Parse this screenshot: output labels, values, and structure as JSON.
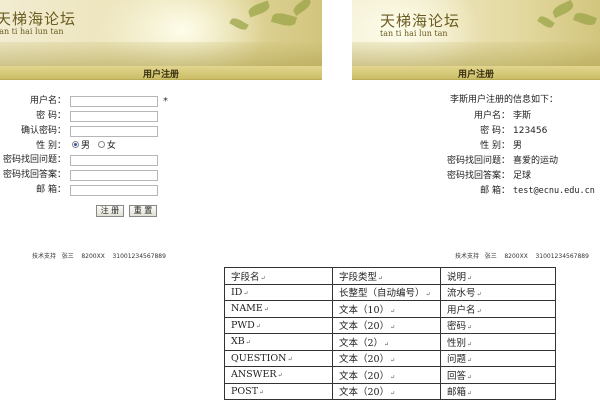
{
  "site": {
    "title": "天梯海论坛",
    "subtitle": "tan ti hai lun tan"
  },
  "register_form": {
    "section_title": "用户注册",
    "fields": [
      {
        "label": "用户名：",
        "value": "",
        "required_mark": "*"
      },
      {
        "label": "密  码：",
        "value": ""
      },
      {
        "label": "确认密码：",
        "value": ""
      },
      {
        "label": "性  别："
      },
      {
        "label": "密码找回问题：",
        "value": ""
      },
      {
        "label": "密码找回答案：",
        "value": ""
      },
      {
        "label": "邮  箱：",
        "value": ""
      }
    ],
    "gender_options": [
      {
        "label": "男",
        "checked": true
      },
      {
        "label": "女",
        "checked": false
      }
    ],
    "submit_label": "注 册",
    "reset_label": "重 置"
  },
  "register_result": {
    "section_title": "用户注册",
    "heading": "李斯用户注册的信息如下：",
    "rows": [
      {
        "label": "用户名：",
        "value": "李斯"
      },
      {
        "label": "密  码：",
        "value": "123456"
      },
      {
        "label": "性  别：",
        "value": "男"
      },
      {
        "label": "密码找回问题：",
        "value": "喜爱的运动"
      },
      {
        "label": "密码找回答案：",
        "value": "足球"
      },
      {
        "label": "邮  箱：",
        "value": "test@ecnu.edu.cn"
      }
    ]
  },
  "footer": {
    "support_text": "技术支持   张三    8200XX    31001234567889"
  },
  "schema_table": {
    "paragraph_mark": "↵",
    "header": [
      "字段名",
      "字段类型",
      "说明"
    ],
    "rows": [
      [
        "ID",
        "长整型（自动编号）",
        "流水号"
      ],
      [
        "NAME",
        "文本（10）",
        "用户名"
      ],
      [
        "PWD",
        "文本（20）",
        "密码"
      ],
      [
        "XB",
        "文本（2）",
        "性别"
      ],
      [
        "QUESTION",
        "文本（20）",
        "问题"
      ],
      [
        "ANSWER",
        "文本（20）",
        "回答"
      ],
      [
        "POST",
        "文本（20）",
        "邮箱"
      ]
    ]
  },
  "colors": {
    "section_bar": "#d8cb7a",
    "banner": "#e6dcaa"
  }
}
